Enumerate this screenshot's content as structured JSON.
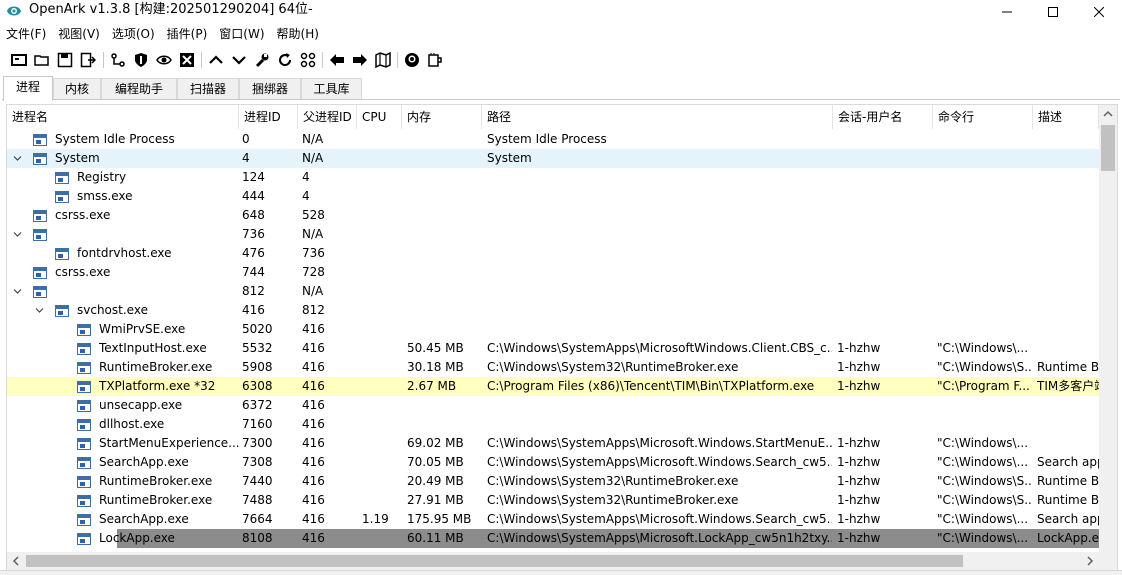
{
  "window": {
    "title": "OpenArk v1.3.8 [构建:202501290204]  64位-"
  },
  "menu": [
    "文件(F)",
    "视图(V)",
    "选项(O)",
    "插件(P)",
    "窗口(W)",
    "帮助(H)"
  ],
  "toolbar": {
    "icons": [
      "console-icon",
      "open-folder-icon",
      "save-icon",
      "export-icon",
      "process-tree-icon",
      "shield-icon",
      "eye-icon",
      "close-box-icon",
      "chevron-up-icon",
      "chevron-down-icon",
      "wrench-icon",
      "refresh-icon",
      "grid-icon",
      "arrow-left-icon",
      "arrow-right-icon",
      "map-icon",
      "github-icon",
      "coffee-icon"
    ]
  },
  "tabs": [
    {
      "label": "进程",
      "active": true
    },
    {
      "label": "内核",
      "active": false
    },
    {
      "label": "编程助手",
      "active": false
    },
    {
      "label": "扫描器",
      "active": false
    },
    {
      "label": "捆绑器",
      "active": false
    },
    {
      "label": "工具库",
      "active": false
    }
  ],
  "columns": [
    "进程名",
    "进程ID",
    "父进程ID",
    "CPU",
    "内存",
    "路径",
    "会话-用户名",
    "命令行",
    "描述"
  ],
  "rows": [
    {
      "name": "System Idle Process",
      "pid": "0",
      "ppid": "N/A",
      "cpu": "",
      "mem": "",
      "path": "System Idle Process",
      "user": "",
      "cmd": "",
      "desc": "",
      "depth": 0,
      "twisty": "",
      "state": ""
    },
    {
      "name": "System",
      "pid": "4",
      "ppid": "N/A",
      "cpu": "",
      "mem": "",
      "path": "System",
      "user": "",
      "cmd": "",
      "desc": "",
      "depth": 0,
      "twisty": "open",
      "state": "sel-light"
    },
    {
      "name": "Registry",
      "pid": "124",
      "ppid": "4",
      "cpu": "",
      "mem": "",
      "path": "",
      "user": "",
      "cmd": "",
      "desc": "",
      "depth": 1,
      "twisty": "",
      "state": ""
    },
    {
      "name": "smss.exe",
      "pid": "444",
      "ppid": "4",
      "cpu": "",
      "mem": "",
      "path": "",
      "user": "",
      "cmd": "",
      "desc": "",
      "depth": 1,
      "twisty": "",
      "state": ""
    },
    {
      "name": "csrss.exe",
      "pid": "648",
      "ppid": "528",
      "cpu": "",
      "mem": "",
      "path": "",
      "user": "",
      "cmd": "",
      "desc": "",
      "depth": 0,
      "twisty": "",
      "state": ""
    },
    {
      "name": "",
      "pid": "736",
      "ppid": "N/A",
      "cpu": "",
      "mem": "",
      "path": "",
      "user": "",
      "cmd": "",
      "desc": "",
      "depth": 0,
      "twisty": "open",
      "state": ""
    },
    {
      "name": "fontdrvhost.exe",
      "pid": "476",
      "ppid": "736",
      "cpu": "",
      "mem": "",
      "path": "",
      "user": "",
      "cmd": "",
      "desc": "",
      "depth": 1,
      "twisty": "",
      "state": ""
    },
    {
      "name": "csrss.exe",
      "pid": "744",
      "ppid": "728",
      "cpu": "",
      "mem": "",
      "path": "",
      "user": "",
      "cmd": "",
      "desc": "",
      "depth": 0,
      "twisty": "",
      "state": ""
    },
    {
      "name": "",
      "pid": "812",
      "ppid": "N/A",
      "cpu": "",
      "mem": "",
      "path": "",
      "user": "",
      "cmd": "",
      "desc": "",
      "depth": 0,
      "twisty": "open",
      "state": ""
    },
    {
      "name": "svchost.exe",
      "pid": "416",
      "ppid": "812",
      "cpu": "",
      "mem": "",
      "path": "",
      "user": "",
      "cmd": "",
      "desc": "",
      "depth": 1,
      "twisty": "open",
      "state": ""
    },
    {
      "name": "WmiPrvSE.exe",
      "pid": "5020",
      "ppid": "416",
      "cpu": "",
      "mem": "",
      "path": "",
      "user": "",
      "cmd": "",
      "desc": "",
      "depth": 2,
      "twisty": "",
      "state": ""
    },
    {
      "name": "TextInputHost.exe",
      "pid": "5532",
      "ppid": "416",
      "cpu": "",
      "mem": "50.45 MB",
      "path": "C:\\Windows\\SystemApps\\MicrosoftWindows.Client.CBS_c...",
      "user": "1-hzhw",
      "cmd": "\"C:\\Windows\\...",
      "desc": "",
      "depth": 2,
      "twisty": "",
      "state": ""
    },
    {
      "name": "RuntimeBroker.exe",
      "pid": "5908",
      "ppid": "416",
      "cpu": "",
      "mem": "30.18 MB",
      "path": "C:\\Windows\\System32\\RuntimeBroker.exe",
      "user": "1-hzhw",
      "cmd": "\"C:\\Windows\\S...",
      "desc": "Runtime Br",
      "depth": 2,
      "twisty": "",
      "state": ""
    },
    {
      "name": "TXPlatform.exe *32",
      "pid": "6308",
      "ppid": "416",
      "cpu": "",
      "mem": "2.67 MB",
      "path": "C:\\Program Files (x86)\\Tencent\\TIM\\Bin\\TXPlatform.exe",
      "user": "1-hzhw",
      "cmd": "\"C:\\Program F...",
      "desc": "TIM多客户端",
      "depth": 2,
      "twisty": "",
      "state": "hl-yellow"
    },
    {
      "name": "unsecapp.exe",
      "pid": "6372",
      "ppid": "416",
      "cpu": "",
      "mem": "",
      "path": "",
      "user": "",
      "cmd": "",
      "desc": "",
      "depth": 2,
      "twisty": "",
      "state": ""
    },
    {
      "name": "dllhost.exe",
      "pid": "7160",
      "ppid": "416",
      "cpu": "",
      "mem": "",
      "path": "",
      "user": "",
      "cmd": "",
      "desc": "",
      "depth": 2,
      "twisty": "",
      "state": ""
    },
    {
      "name": "StartMenuExperience...",
      "pid": "7300",
      "ppid": "416",
      "cpu": "",
      "mem": "69.02 MB",
      "path": "C:\\Windows\\SystemApps\\Microsoft.Windows.StartMenuE...",
      "user": "1-hzhw",
      "cmd": "\"C:\\Windows\\...",
      "desc": "",
      "depth": 2,
      "twisty": "",
      "state": ""
    },
    {
      "name": "SearchApp.exe",
      "pid": "7308",
      "ppid": "416",
      "cpu": "",
      "mem": "70.05 MB",
      "path": "C:\\Windows\\SystemApps\\Microsoft.Windows.Search_cw5...",
      "user": "1-hzhw",
      "cmd": "\"C:\\Windows\\...",
      "desc": "Search app",
      "depth": 2,
      "twisty": "",
      "state": ""
    },
    {
      "name": "RuntimeBroker.exe",
      "pid": "7440",
      "ppid": "416",
      "cpu": "",
      "mem": "20.49 MB",
      "path": "C:\\Windows\\System32\\RuntimeBroker.exe",
      "user": "1-hzhw",
      "cmd": "\"C:\\Windows\\S...",
      "desc": "Runtime Br",
      "depth": 2,
      "twisty": "",
      "state": ""
    },
    {
      "name": "RuntimeBroker.exe",
      "pid": "7488",
      "ppid": "416",
      "cpu": "",
      "mem": "27.91 MB",
      "path": "C:\\Windows\\System32\\RuntimeBroker.exe",
      "user": "1-hzhw",
      "cmd": "\"C:\\Windows\\S...",
      "desc": "Runtime Br",
      "depth": 2,
      "twisty": "",
      "state": ""
    },
    {
      "name": "SearchApp.exe",
      "pid": "7664",
      "ppid": "416",
      "cpu": "1.19",
      "mem": "175.95 MB",
      "path": "C:\\Windows\\SystemApps\\Microsoft.Windows.Search_cw5...",
      "user": "1-hzhw",
      "cmd": "\"C:\\Windows\\...",
      "desc": "Search app",
      "depth": 2,
      "twisty": "",
      "state": ""
    },
    {
      "name": "LockApp.exe",
      "pid": "8108",
      "ppid": "416",
      "cpu": "",
      "mem": "60.11 MB",
      "path": "C:\\Windows\\SystemApps\\Microsoft.LockApp_cw5n1h2txy...",
      "user": "1-hzhw",
      "cmd": "\"C:\\Windows\\...",
      "desc": "LockApp.ex",
      "depth": 2,
      "twisty": "",
      "state": "sel-dark"
    }
  ]
}
